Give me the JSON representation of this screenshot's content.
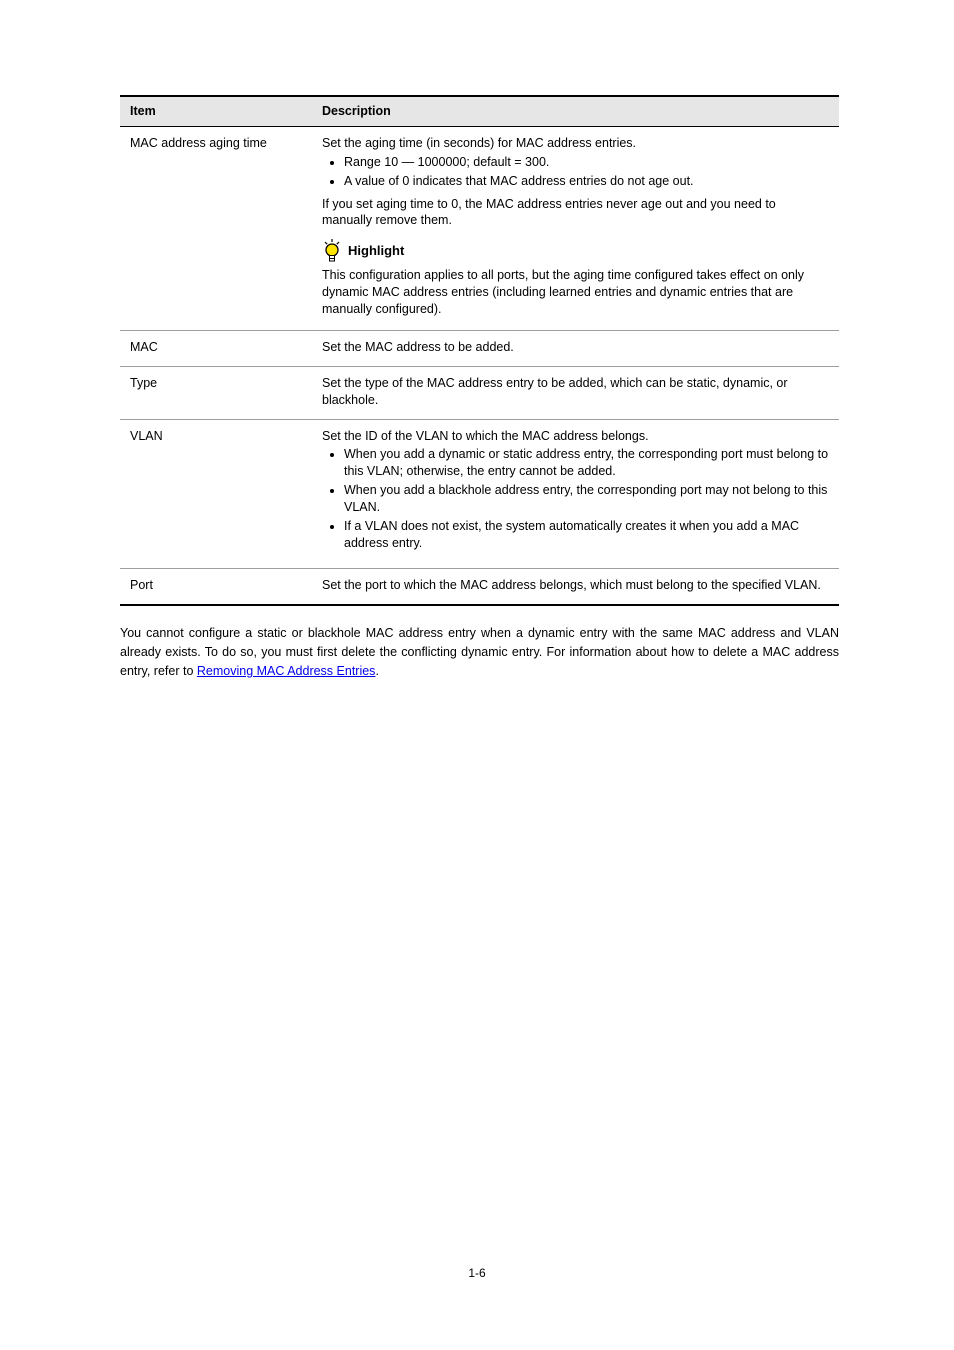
{
  "table": {
    "headers": {
      "col1": "Item",
      "col2": "Description"
    },
    "rows": [
      {
        "label": "MAC address aging time",
        "intro": "Set the aging time (in seconds) for MAC address entries.",
        "bullets": [
          "Range 10 — 1000000; default = 300.",
          "A value of 0 indicates that MAC address entries do not age out."
        ],
        "outro": "If you set aging time to 0, the MAC address entries never age out and you need to manually remove them.",
        "highlight_label": "Highlight",
        "highlight_text": "This configuration applies to all ports, but the aging time configured takes effect on only dynamic MAC address entries (including learned entries and dynamic entries that are manually configured)."
      },
      {
        "label": "MAC",
        "text": "Set the MAC address to be added."
      },
      {
        "label": "Type",
        "text": "Set the type of the MAC address entry to be added, which can be static, dynamic, or blackhole."
      },
      {
        "label": "VLAN",
        "intro": "Set the ID of the VLAN to which the MAC address belongs.",
        "bullets": [
          "When you add a dynamic or static address entry, the corresponding port must belong to this VLAN; otherwise, the entry cannot be added.",
          "When you add a blackhole address entry, the corresponding port may not belong to this VLAN.",
          "If a VLAN does not exist, the system automatically creates it when you add a MAC address entry."
        ]
      },
      {
        "label": "Port",
        "text": "Set the port to which the MAC address belongs, which must belong to the specified VLAN."
      }
    ]
  },
  "paragraph_parts": {
    "p1": "You cannot configure a static or blackhole MAC address entry when a dynamic entry with the same MAC address and VLAN already exists. To do so, you must first delete the conflicting dynamic entry. For information about how to delete a MAC address entry, refer to ",
    "link": "Removing MAC Address Entries",
    "p2": "."
  },
  "page_number": "1-6"
}
